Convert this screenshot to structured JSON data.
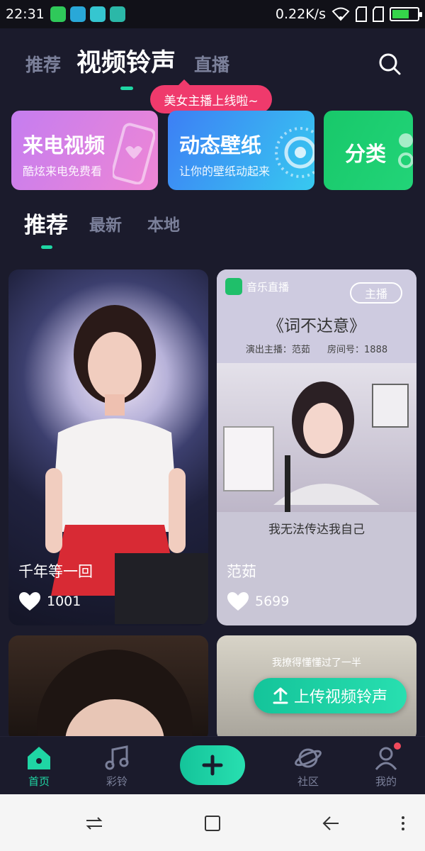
{
  "status_bar": {
    "time": "22:31",
    "net_speed": "0.22K/s",
    "app_icons": [
      "wechat-icon",
      "browser-icon",
      "app-icon",
      "usb-icon"
    ]
  },
  "header": {
    "tabs": [
      {
        "label": "推荐",
        "active": false
      },
      {
        "label": "视频铃声",
        "active": true
      },
      {
        "label": "直播",
        "active": false
      }
    ],
    "search_icon": "search-icon",
    "tooltip": "美女主播上线啦~"
  },
  "features": [
    {
      "title": "来电视频",
      "subtitle": "酷炫来电免费看"
    },
    {
      "title": "动态壁纸",
      "subtitle": "让你的壁纸动起来"
    },
    {
      "title": "分类"
    }
  ],
  "sub_tabs": [
    {
      "label": "推荐",
      "active": true
    },
    {
      "label": "最新",
      "active": false
    },
    {
      "label": "本地",
      "active": false
    }
  ],
  "videos": [
    {
      "title": "千年等一回",
      "likes": "1001"
    },
    {
      "title": "范茹",
      "likes": "5699",
      "logo_text": "音乐直播",
      "badge": "主播",
      "song": "《词不达意》",
      "meta": "演出主播：范茹 房间号：1888",
      "caption": "我无法传达我自己"
    },
    {
      "title": ""
    },
    {
      "title": "",
      "caption": "我撩得懂懂过了一半"
    }
  ],
  "upload_button": "上传视频铃声",
  "bottom_nav": {
    "items": [
      {
        "label": "首页",
        "icon": "home-icon",
        "active": true
      },
      {
        "label": "彩铃",
        "icon": "music-note-icon",
        "active": false
      },
      {
        "label": "",
        "icon": "plus-icon",
        "active": false
      },
      {
        "label": "社区",
        "icon": "planet-icon",
        "active": false
      },
      {
        "label": "我的",
        "icon": "profile-icon",
        "active": false
      }
    ]
  },
  "colors": {
    "background": "#1b1b2c",
    "accent": "#1fd6a4",
    "tooltip": "#ef3a6c",
    "inactive_text": "#7b809a"
  }
}
